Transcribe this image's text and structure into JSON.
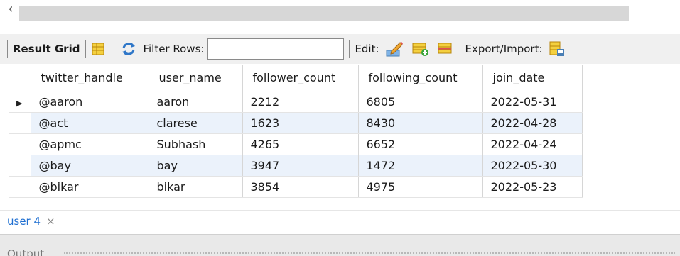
{
  "toolbar": {
    "result_grid_label": "Result Grid",
    "filter_rows_label": "Filter Rows:",
    "filter_value": "",
    "edit_label": "Edit:",
    "export_import_label": "Export/Import:"
  },
  "grid": {
    "columns": [
      "twitter_handle",
      "user_name",
      "follower_count",
      "following_count",
      "join_date"
    ],
    "rows": [
      [
        "@aaron",
        "aaron",
        "2212",
        "6805",
        "2022-05-31"
      ],
      [
        "@act",
        "clarese",
        "1623",
        "8430",
        "2022-04-28"
      ],
      [
        "@apmc",
        "Subhash",
        "4265",
        "6652",
        "2022-04-24"
      ],
      [
        "@bay",
        "bay",
        "3947",
        "1472",
        "2022-05-30"
      ],
      [
        "@bikar",
        "bikar",
        "3854",
        "4975",
        "2022-05-23"
      ]
    ],
    "selected_row_marker": "▶"
  },
  "tabs": {
    "active_label": "user 4",
    "close_glyph": "×"
  },
  "output": {
    "label": "Output"
  },
  "scroll": {
    "left_glyph": "‹"
  },
  "icons": {
    "form_editor": "form-editor-icon",
    "refresh": "refresh-icon",
    "edit_pencil": "pencil-edit-icon",
    "add_row": "add-row-icon",
    "delete_row": "delete-row-icon",
    "export": "export-icon"
  }
}
